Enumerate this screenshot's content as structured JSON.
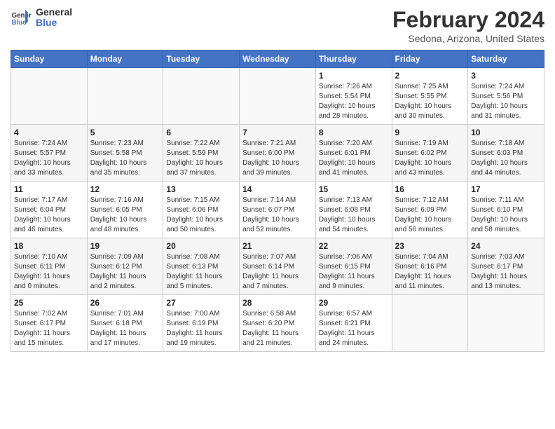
{
  "header": {
    "logo_line1": "General",
    "logo_line2": "Blue",
    "main_title": "February 2024",
    "subtitle": "Sedona, Arizona, United States"
  },
  "days_of_week": [
    "Sunday",
    "Monday",
    "Tuesday",
    "Wednesday",
    "Thursday",
    "Friday",
    "Saturday"
  ],
  "weeks": [
    [
      {
        "day": "",
        "detail": ""
      },
      {
        "day": "",
        "detail": ""
      },
      {
        "day": "",
        "detail": ""
      },
      {
        "day": "",
        "detail": ""
      },
      {
        "day": "1",
        "detail": "Sunrise: 7:26 AM\nSunset: 5:54 PM\nDaylight: 10 hours\nand 28 minutes."
      },
      {
        "day": "2",
        "detail": "Sunrise: 7:25 AM\nSunset: 5:55 PM\nDaylight: 10 hours\nand 30 minutes."
      },
      {
        "day": "3",
        "detail": "Sunrise: 7:24 AM\nSunset: 5:56 PM\nDaylight: 10 hours\nand 31 minutes."
      }
    ],
    [
      {
        "day": "4",
        "detail": "Sunrise: 7:24 AM\nSunset: 5:57 PM\nDaylight: 10 hours\nand 33 minutes."
      },
      {
        "day": "5",
        "detail": "Sunrise: 7:23 AM\nSunset: 5:58 PM\nDaylight: 10 hours\nand 35 minutes."
      },
      {
        "day": "6",
        "detail": "Sunrise: 7:22 AM\nSunset: 5:59 PM\nDaylight: 10 hours\nand 37 minutes."
      },
      {
        "day": "7",
        "detail": "Sunrise: 7:21 AM\nSunset: 6:00 PM\nDaylight: 10 hours\nand 39 minutes."
      },
      {
        "day": "8",
        "detail": "Sunrise: 7:20 AM\nSunset: 6:01 PM\nDaylight: 10 hours\nand 41 minutes."
      },
      {
        "day": "9",
        "detail": "Sunrise: 7:19 AM\nSunset: 6:02 PM\nDaylight: 10 hours\nand 43 minutes."
      },
      {
        "day": "10",
        "detail": "Sunrise: 7:18 AM\nSunset: 6:03 PM\nDaylight: 10 hours\nand 44 minutes."
      }
    ],
    [
      {
        "day": "11",
        "detail": "Sunrise: 7:17 AM\nSunset: 6:04 PM\nDaylight: 10 hours\nand 46 minutes."
      },
      {
        "day": "12",
        "detail": "Sunrise: 7:16 AM\nSunset: 6:05 PM\nDaylight: 10 hours\nand 48 minutes."
      },
      {
        "day": "13",
        "detail": "Sunrise: 7:15 AM\nSunset: 6:06 PM\nDaylight: 10 hours\nand 50 minutes."
      },
      {
        "day": "14",
        "detail": "Sunrise: 7:14 AM\nSunset: 6:07 PM\nDaylight: 10 hours\nand 52 minutes."
      },
      {
        "day": "15",
        "detail": "Sunrise: 7:13 AM\nSunset: 6:08 PM\nDaylight: 10 hours\nand 54 minutes."
      },
      {
        "day": "16",
        "detail": "Sunrise: 7:12 AM\nSunset: 6:09 PM\nDaylight: 10 hours\nand 56 minutes."
      },
      {
        "day": "17",
        "detail": "Sunrise: 7:11 AM\nSunset: 6:10 PM\nDaylight: 10 hours\nand 58 minutes."
      }
    ],
    [
      {
        "day": "18",
        "detail": "Sunrise: 7:10 AM\nSunset: 6:11 PM\nDaylight: 11 hours\nand 0 minutes."
      },
      {
        "day": "19",
        "detail": "Sunrise: 7:09 AM\nSunset: 6:12 PM\nDaylight: 11 hours\nand 2 minutes."
      },
      {
        "day": "20",
        "detail": "Sunrise: 7:08 AM\nSunset: 6:13 PM\nDaylight: 11 hours\nand 5 minutes."
      },
      {
        "day": "21",
        "detail": "Sunrise: 7:07 AM\nSunset: 6:14 PM\nDaylight: 11 hours\nand 7 minutes."
      },
      {
        "day": "22",
        "detail": "Sunrise: 7:06 AM\nSunset: 6:15 PM\nDaylight: 11 hours\nand 9 minutes."
      },
      {
        "day": "23",
        "detail": "Sunrise: 7:04 AM\nSunset: 6:16 PM\nDaylight: 11 hours\nand 11 minutes."
      },
      {
        "day": "24",
        "detail": "Sunrise: 7:03 AM\nSunset: 6:17 PM\nDaylight: 11 hours\nand 13 minutes."
      }
    ],
    [
      {
        "day": "25",
        "detail": "Sunrise: 7:02 AM\nSunset: 6:17 PM\nDaylight: 11 hours\nand 15 minutes."
      },
      {
        "day": "26",
        "detail": "Sunrise: 7:01 AM\nSunset: 6:18 PM\nDaylight: 11 hours\nand 17 minutes."
      },
      {
        "day": "27",
        "detail": "Sunrise: 7:00 AM\nSunset: 6:19 PM\nDaylight: 11 hours\nand 19 minutes."
      },
      {
        "day": "28",
        "detail": "Sunrise: 6:58 AM\nSunset: 6:20 PM\nDaylight: 11 hours\nand 21 minutes."
      },
      {
        "day": "29",
        "detail": "Sunrise: 6:57 AM\nSunset: 6:21 PM\nDaylight: 11 hours\nand 24 minutes."
      },
      {
        "day": "",
        "detail": ""
      },
      {
        "day": "",
        "detail": ""
      }
    ]
  ]
}
